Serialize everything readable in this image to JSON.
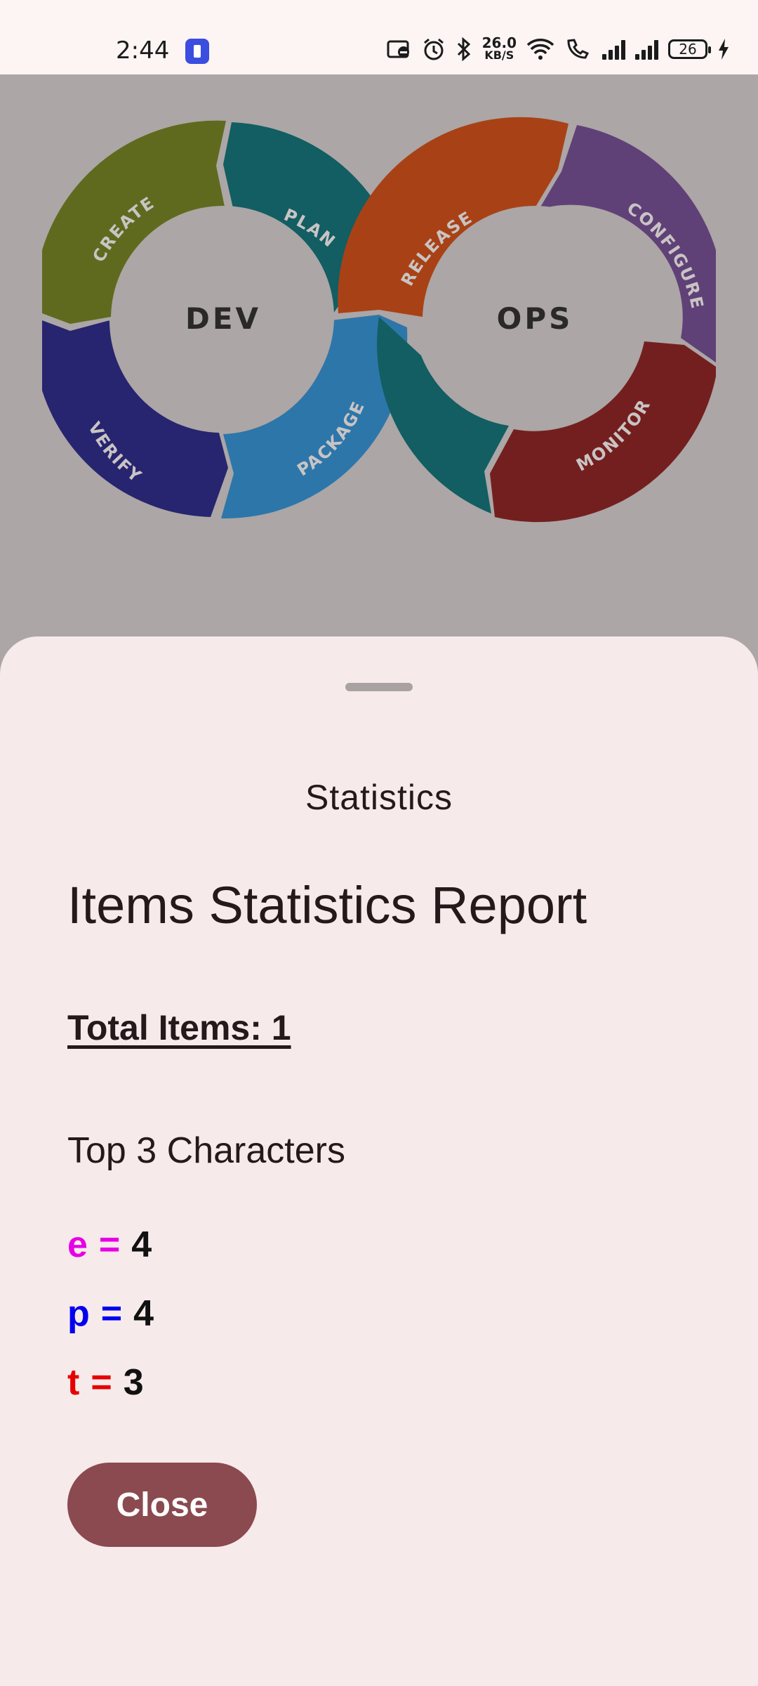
{
  "status_bar": {
    "time": "2:44",
    "speed_value": "26.0",
    "speed_unit": "KB/S",
    "battery": "26",
    "icons": [
      "flashlight-app-icon",
      "nfc-icon",
      "alarm-icon",
      "bluetooth-icon",
      "wifi-icon",
      "call-icon",
      "signal-icon",
      "signal-icon",
      "battery-icon",
      "charging-icon"
    ]
  },
  "carousel": {
    "diagram": {
      "left_label": "DEV",
      "right_label": "OPS",
      "segments": [
        "CREATE",
        "PLAN",
        "VERIFY",
        "PACKAGE",
        "RELEASE",
        "CONFIGURE",
        "MONITOR"
      ],
      "colors": {
        "create": "#5f6a1e",
        "plan": "#125e62",
        "verify": "#27256f",
        "package": "#2d76aa",
        "release": "#a84216",
        "configure": "#604177",
        "monitor": "#741f1f"
      }
    },
    "dot_count": 10,
    "active_index": 2
  },
  "sheet": {
    "title": "Statistics",
    "report_title": "Items Statistics Report",
    "total_items": "Total Items: 1",
    "top_label": "Top 3 Characters",
    "characters": [
      {
        "char": "e",
        "eq": "=",
        "count": "4",
        "color": "#e600e6"
      },
      {
        "char": "p",
        "eq": "=",
        "count": "4",
        "color": "#0000ee"
      },
      {
        "char": "t",
        "eq": "=",
        "count": "3",
        "color": "#e60000"
      }
    ],
    "close_label": "Close"
  }
}
